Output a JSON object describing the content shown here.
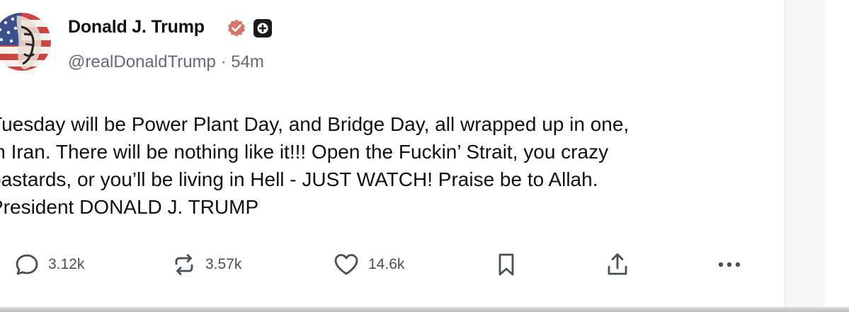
{
  "post": {
    "display_name": "Donald J. Trump",
    "handle": "@realDonaldTrump",
    "separator": "·",
    "age": "54m",
    "body_lines": [
      "Tuesday will be Power Plant Day, and Bridge Day, all wrapped up in one,",
      "in Iran. There will be nothing like it!!! Open the Fuckin’ Strait, you crazy",
      "bastards, or you’ll be living in Hell - JUST WATCH! Praise be to Allah.",
      "President DONALD J. TRUMP"
    ]
  },
  "actions": {
    "replies": "3.12k",
    "reposts": "3.57k",
    "likes": "14.6k"
  },
  "icons": {
    "verified": "verified-badge-icon",
    "plus": "plus-badge-icon",
    "reply": "reply-icon",
    "repost": "repost-icon",
    "like": "heart-icon",
    "bookmark": "bookmark-icon",
    "share": "share-icon",
    "more": "more-icon"
  },
  "colors": {
    "verified_badge": "#d6756a",
    "text": "#111111",
    "muted": "#666a70",
    "icon": "#4a4e55"
  }
}
